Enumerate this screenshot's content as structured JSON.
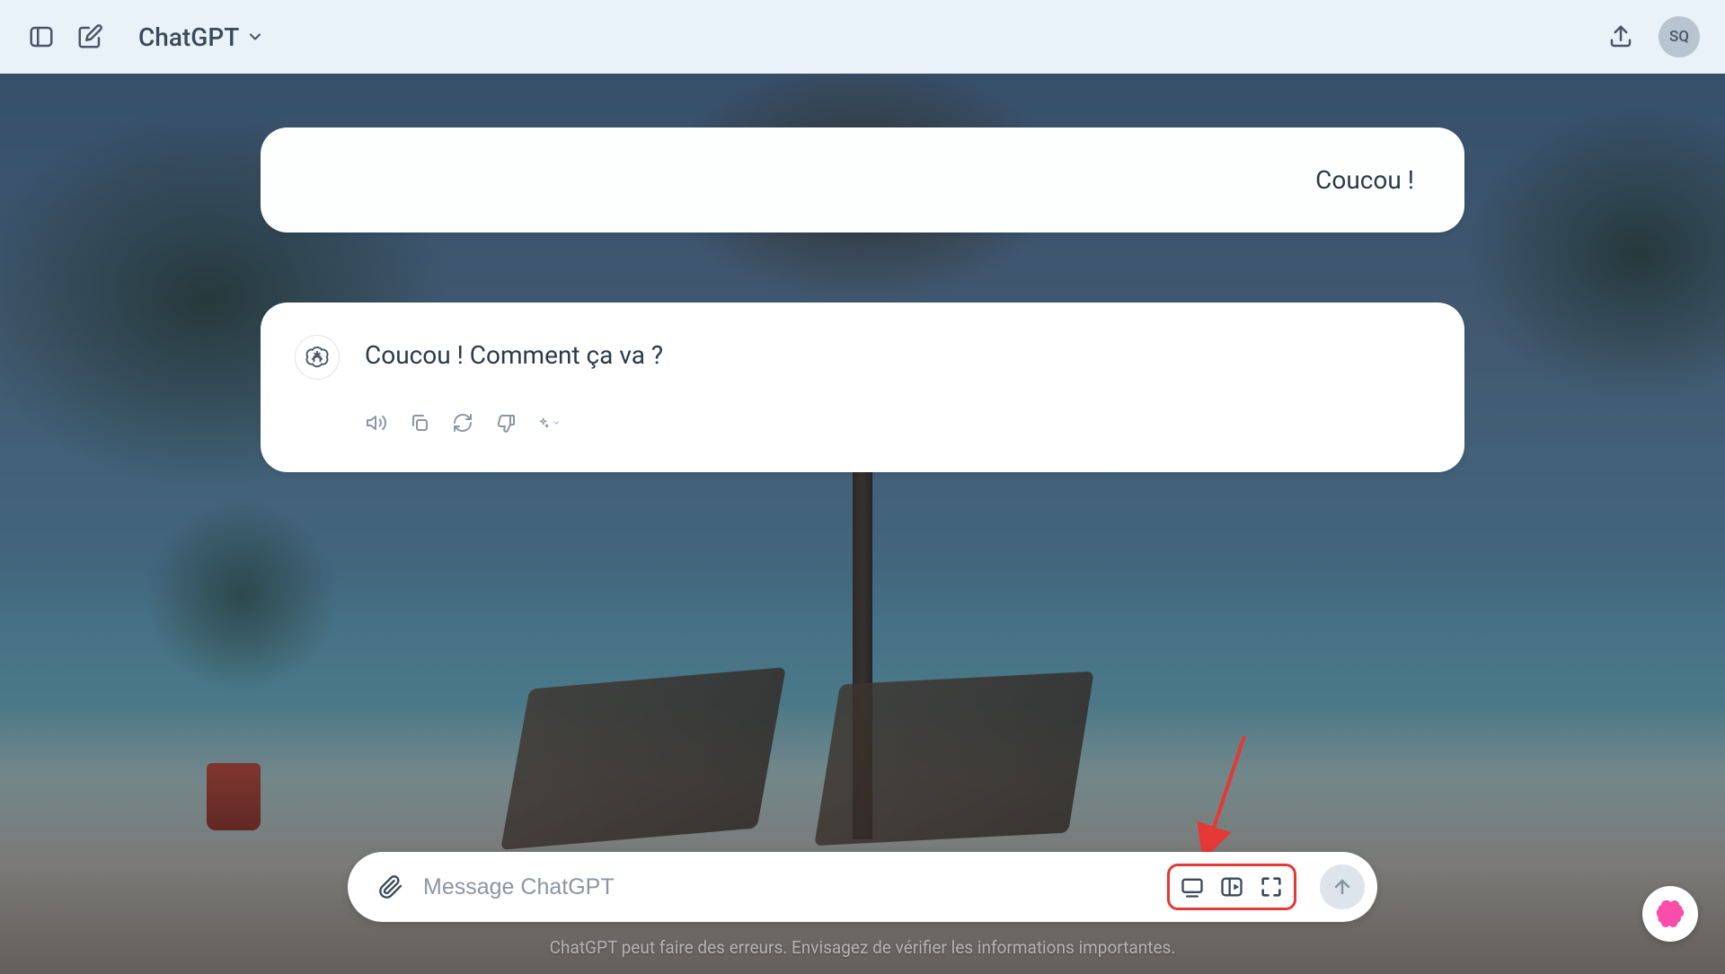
{
  "header": {
    "title": "ChatGPT",
    "avatar_initials": "SQ"
  },
  "conversation": {
    "user_message": "Coucou !",
    "assistant_message": "Coucou ! Comment ça va ?"
  },
  "composer": {
    "placeholder": "Message ChatGPT"
  },
  "footer": {
    "disclaimer": "ChatGPT peut faire des erreurs. Envisagez de vérifier les informations importantes."
  },
  "colors": {
    "highlight_box": "#e53935"
  }
}
